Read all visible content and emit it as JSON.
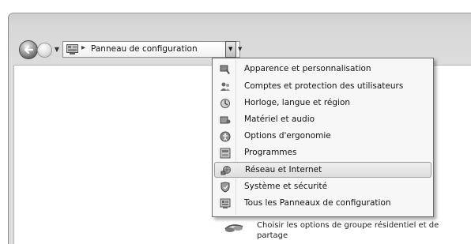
{
  "address_bar": {
    "current_location": "Panneau de configuration"
  },
  "dropdown": {
    "items": [
      {
        "label": "Apparence et personnalisation",
        "icon": "appearance-icon"
      },
      {
        "label": "Comptes et protection des utilisateurs",
        "icon": "users-icon"
      },
      {
        "label": "Horloge, langue et région",
        "icon": "clock-language-icon"
      },
      {
        "label": "Matériel et audio",
        "icon": "hardware-audio-icon"
      },
      {
        "label": "Options d'ergonomie",
        "icon": "ease-of-access-icon"
      },
      {
        "label": "Programmes",
        "icon": "programs-icon"
      },
      {
        "label": "Réseau et Internet",
        "icon": "network-icon",
        "highlighted": true
      },
      {
        "label": "Système et sécurité",
        "icon": "system-security-icon"
      },
      {
        "label": "Tous les Panneaux de configuration",
        "icon": "all-control-panels-icon"
      }
    ]
  },
  "background_item": {
    "line1": "Choisir les options de groupe résidentiel et de",
    "line2": "partage",
    "icon": "homegroup-icon"
  }
}
